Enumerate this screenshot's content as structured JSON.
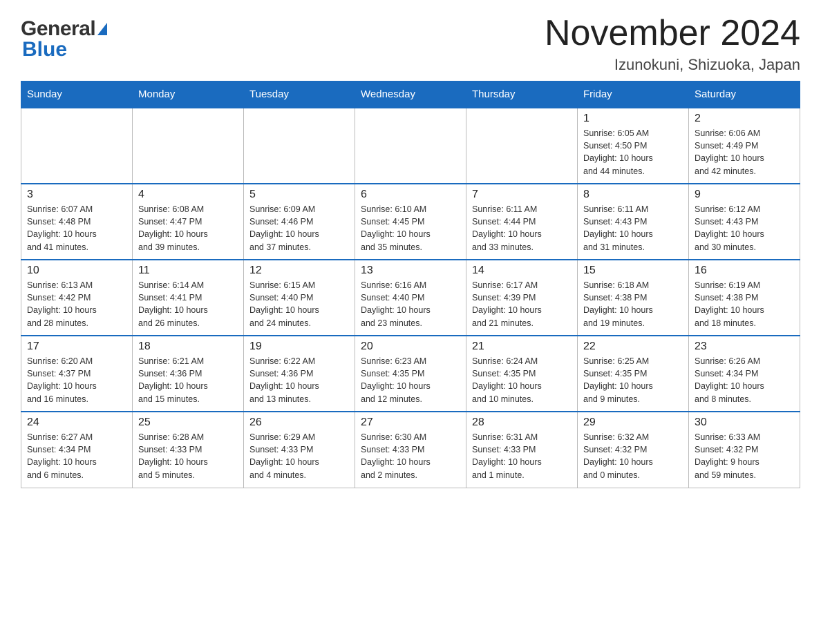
{
  "header": {
    "logo_general": "General",
    "logo_blue": "Blue",
    "month_title": "November 2024",
    "location": "Izunokuni, Shizuoka, Japan"
  },
  "weekdays": [
    "Sunday",
    "Monday",
    "Tuesday",
    "Wednesday",
    "Thursday",
    "Friday",
    "Saturday"
  ],
  "weeks": [
    [
      {
        "day": "",
        "info": ""
      },
      {
        "day": "",
        "info": ""
      },
      {
        "day": "",
        "info": ""
      },
      {
        "day": "",
        "info": ""
      },
      {
        "day": "",
        "info": ""
      },
      {
        "day": "1",
        "info": "Sunrise: 6:05 AM\nSunset: 4:50 PM\nDaylight: 10 hours\nand 44 minutes."
      },
      {
        "day": "2",
        "info": "Sunrise: 6:06 AM\nSunset: 4:49 PM\nDaylight: 10 hours\nand 42 minutes."
      }
    ],
    [
      {
        "day": "3",
        "info": "Sunrise: 6:07 AM\nSunset: 4:48 PM\nDaylight: 10 hours\nand 41 minutes."
      },
      {
        "day": "4",
        "info": "Sunrise: 6:08 AM\nSunset: 4:47 PM\nDaylight: 10 hours\nand 39 minutes."
      },
      {
        "day": "5",
        "info": "Sunrise: 6:09 AM\nSunset: 4:46 PM\nDaylight: 10 hours\nand 37 minutes."
      },
      {
        "day": "6",
        "info": "Sunrise: 6:10 AM\nSunset: 4:45 PM\nDaylight: 10 hours\nand 35 minutes."
      },
      {
        "day": "7",
        "info": "Sunrise: 6:11 AM\nSunset: 4:44 PM\nDaylight: 10 hours\nand 33 minutes."
      },
      {
        "day": "8",
        "info": "Sunrise: 6:11 AM\nSunset: 4:43 PM\nDaylight: 10 hours\nand 31 minutes."
      },
      {
        "day": "9",
        "info": "Sunrise: 6:12 AM\nSunset: 4:43 PM\nDaylight: 10 hours\nand 30 minutes."
      }
    ],
    [
      {
        "day": "10",
        "info": "Sunrise: 6:13 AM\nSunset: 4:42 PM\nDaylight: 10 hours\nand 28 minutes."
      },
      {
        "day": "11",
        "info": "Sunrise: 6:14 AM\nSunset: 4:41 PM\nDaylight: 10 hours\nand 26 minutes."
      },
      {
        "day": "12",
        "info": "Sunrise: 6:15 AM\nSunset: 4:40 PM\nDaylight: 10 hours\nand 24 minutes."
      },
      {
        "day": "13",
        "info": "Sunrise: 6:16 AM\nSunset: 4:40 PM\nDaylight: 10 hours\nand 23 minutes."
      },
      {
        "day": "14",
        "info": "Sunrise: 6:17 AM\nSunset: 4:39 PM\nDaylight: 10 hours\nand 21 minutes."
      },
      {
        "day": "15",
        "info": "Sunrise: 6:18 AM\nSunset: 4:38 PM\nDaylight: 10 hours\nand 19 minutes."
      },
      {
        "day": "16",
        "info": "Sunrise: 6:19 AM\nSunset: 4:38 PM\nDaylight: 10 hours\nand 18 minutes."
      }
    ],
    [
      {
        "day": "17",
        "info": "Sunrise: 6:20 AM\nSunset: 4:37 PM\nDaylight: 10 hours\nand 16 minutes."
      },
      {
        "day": "18",
        "info": "Sunrise: 6:21 AM\nSunset: 4:36 PM\nDaylight: 10 hours\nand 15 minutes."
      },
      {
        "day": "19",
        "info": "Sunrise: 6:22 AM\nSunset: 4:36 PM\nDaylight: 10 hours\nand 13 minutes."
      },
      {
        "day": "20",
        "info": "Sunrise: 6:23 AM\nSunset: 4:35 PM\nDaylight: 10 hours\nand 12 minutes."
      },
      {
        "day": "21",
        "info": "Sunrise: 6:24 AM\nSunset: 4:35 PM\nDaylight: 10 hours\nand 10 minutes."
      },
      {
        "day": "22",
        "info": "Sunrise: 6:25 AM\nSunset: 4:35 PM\nDaylight: 10 hours\nand 9 minutes."
      },
      {
        "day": "23",
        "info": "Sunrise: 6:26 AM\nSunset: 4:34 PM\nDaylight: 10 hours\nand 8 minutes."
      }
    ],
    [
      {
        "day": "24",
        "info": "Sunrise: 6:27 AM\nSunset: 4:34 PM\nDaylight: 10 hours\nand 6 minutes."
      },
      {
        "day": "25",
        "info": "Sunrise: 6:28 AM\nSunset: 4:33 PM\nDaylight: 10 hours\nand 5 minutes."
      },
      {
        "day": "26",
        "info": "Sunrise: 6:29 AM\nSunset: 4:33 PM\nDaylight: 10 hours\nand 4 minutes."
      },
      {
        "day": "27",
        "info": "Sunrise: 6:30 AM\nSunset: 4:33 PM\nDaylight: 10 hours\nand 2 minutes."
      },
      {
        "day": "28",
        "info": "Sunrise: 6:31 AM\nSunset: 4:33 PM\nDaylight: 10 hours\nand 1 minute."
      },
      {
        "day": "29",
        "info": "Sunrise: 6:32 AM\nSunset: 4:32 PM\nDaylight: 10 hours\nand 0 minutes."
      },
      {
        "day": "30",
        "info": "Sunrise: 6:33 AM\nSunset: 4:32 PM\nDaylight: 9 hours\nand 59 minutes."
      }
    ]
  ]
}
